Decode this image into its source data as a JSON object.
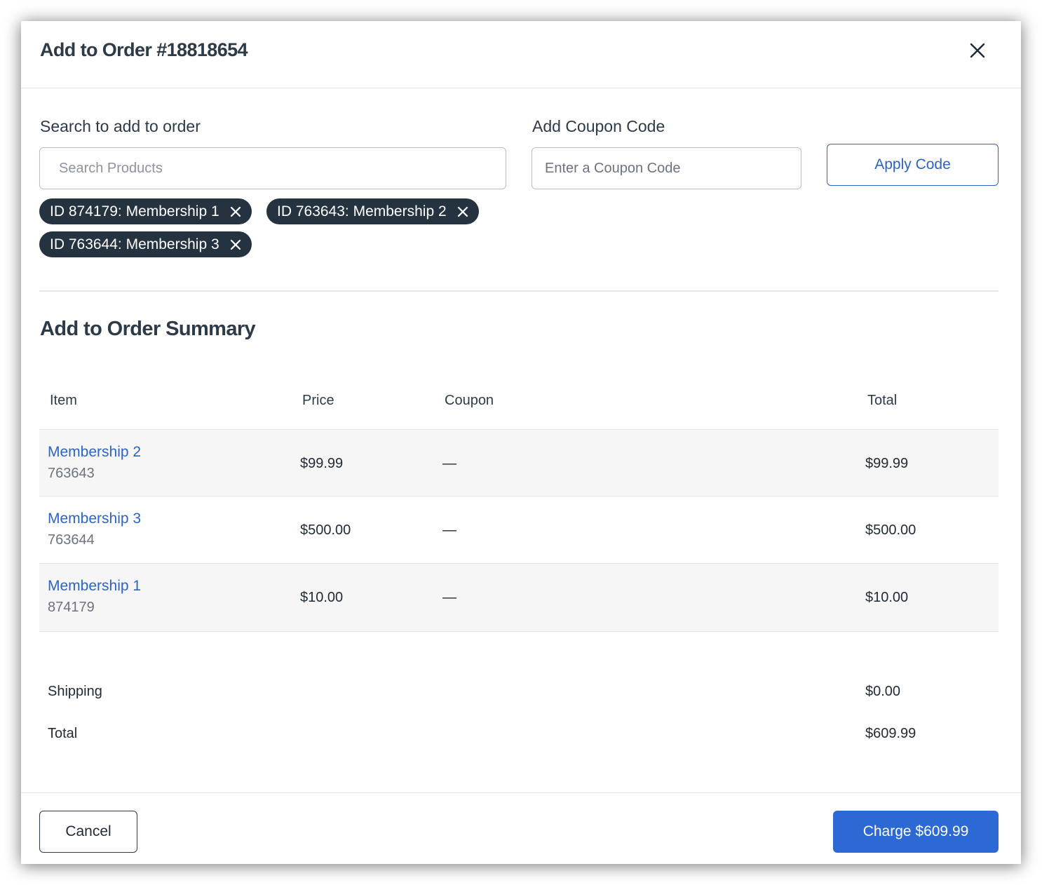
{
  "modal": {
    "title": "Add to Order #18818654",
    "close_icon": "close-icon"
  },
  "search": {
    "label": "Search to add to order",
    "placeholder": "Search Products",
    "value": ""
  },
  "coupon": {
    "label": "Add Coupon Code",
    "placeholder": "Enter a Coupon Code",
    "value": "",
    "apply_label": "Apply Code"
  },
  "selected_chips": [
    {
      "label": "ID 874179: Membership 1"
    },
    {
      "label": "ID 763643: Membership 2"
    },
    {
      "label": "ID 763644: Membership 3"
    }
  ],
  "summary": {
    "title": "Add to Order Summary",
    "columns": {
      "item": "Item",
      "price": "Price",
      "coupon": "Coupon",
      "total": "Total"
    },
    "rows": [
      {
        "name": "Membership 2",
        "id": "763643",
        "price": "$99.99",
        "coupon": "—",
        "total": "$99.99"
      },
      {
        "name": "Membership 3",
        "id": "763644",
        "price": "$500.00",
        "coupon": "—",
        "total": "$500.00"
      },
      {
        "name": "Membership 1",
        "id": "874179",
        "price": "$10.00",
        "coupon": "—",
        "total": "$10.00"
      }
    ],
    "shipping_label": "Shipping",
    "shipping_value": "$0.00",
    "total_label": "Total",
    "total_value": "$609.99"
  },
  "footer": {
    "cancel_label": "Cancel",
    "charge_label": "Charge $609.99"
  },
  "colors": {
    "accent": "#2d69d4",
    "chip_bg": "#253240",
    "row_shade": "#f6f6f7"
  }
}
